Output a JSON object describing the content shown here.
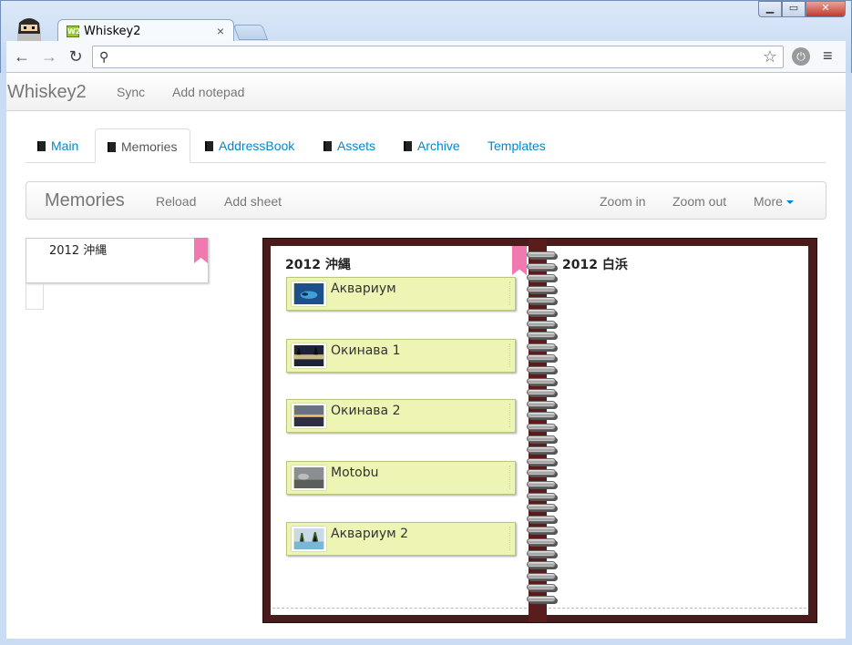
{
  "browser": {
    "tab_title": "Whiskey2",
    "tab_favicon": "W2",
    "tab_close": "×",
    "address": "",
    "back_icon": "←",
    "forward_icon": "→",
    "reload_icon": "↻",
    "search_icon": "⚲",
    "star_icon": "☆",
    "menu_icon": "≡",
    "window_buttons": {
      "minimize": "▁",
      "maximize": "▭",
      "close": "✕"
    }
  },
  "app": {
    "brand": "Whiskey2",
    "nav": {
      "sync": "Sync",
      "add_notepad": "Add notepad"
    },
    "tabs": [
      {
        "label": "Main",
        "icon": "book-icon",
        "active": false
      },
      {
        "label": "Memories",
        "icon": "book-icon",
        "active": true
      },
      {
        "label": "AddressBook",
        "icon": "book-icon",
        "active": false
      },
      {
        "label": "Assets",
        "icon": "book-icon",
        "active": false
      },
      {
        "label": "Archive",
        "icon": "book-icon",
        "active": false
      },
      {
        "label": "Templates",
        "icon": "",
        "active": false
      }
    ],
    "subbar": {
      "title": "Memories",
      "reload": "Reload",
      "add_sheet": "Add sheet",
      "zoom_in": "Zoom in",
      "zoom_out": "Zoom out",
      "more": "More"
    },
    "sheet_list": {
      "items": [
        "2012 沖縄"
      ]
    },
    "notebook": {
      "left_page_title": "2012 沖縄",
      "right_page_title": "2012 白浜",
      "cards": [
        {
          "label": "Аквариум",
          "thumb": "aquarium-photo"
        },
        {
          "label": "Окинава 1",
          "thumb": "okinawa-night-photo"
        },
        {
          "label": "Окинава 2",
          "thumb": "sunset-photo"
        },
        {
          "label": "Motobu",
          "thumb": "motobu-photo"
        },
        {
          "label": "Аквариум 2",
          "thumb": "aquarium-2-photo"
        }
      ]
    }
  },
  "colors": {
    "link": "#0088cc",
    "card_bg": "#eef5b4",
    "ribbon": "#f07ab0",
    "notebook_frame": "#4a1b1b"
  }
}
